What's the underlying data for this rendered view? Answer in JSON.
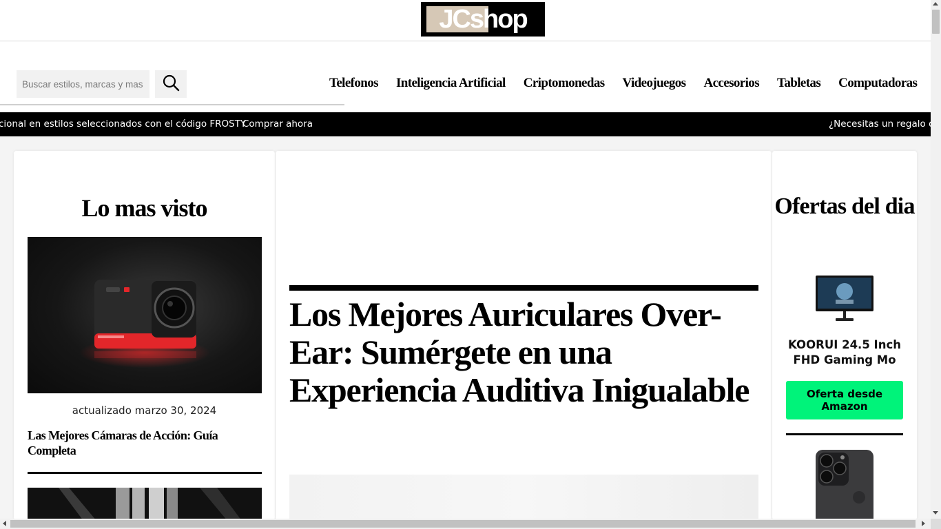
{
  "brand": {
    "logo_text": "JCshop"
  },
  "search": {
    "placeholder": "Buscar estilos, marcas y mas",
    "button_icon": "search-icon"
  },
  "nav": {
    "items": [
      {
        "label": "Telefonos"
      },
      {
        "label": "Inteligencia Artificial"
      },
      {
        "label": "Criptomonedas"
      },
      {
        "label": "Videojuegos"
      },
      {
        "label": "Accesorios"
      },
      {
        "label": "Tabletas"
      },
      {
        "label": "Computadoras"
      }
    ]
  },
  "promo": {
    "text": "cional en estilos seleccionados con el código FROSTY",
    "link": "Comprar ahora",
    "text_2": "¿Necesitas un regalo de"
  },
  "most_viewed": {
    "title": "Lo mas visto",
    "items": [
      {
        "date": "actualizado marzo 30, 2024",
        "title": "Las Mejores Cámaras de Acción: Guía Completa"
      }
    ]
  },
  "article": {
    "title": "Los Mejores Auriculares Over-Ear: Sumérgete en una Experiencia Auditiva Inigualable"
  },
  "deals": {
    "title": "Ofertas del dia",
    "products": [
      {
        "name": "KOORUI 24.5 Inch FHD Gaming Mo",
        "button": "Oferta desde Amazon"
      }
    ]
  },
  "colors": {
    "accent_button": "#00f37a",
    "promo_bar": "#000000",
    "logo_beige": "#d6c8b6"
  }
}
